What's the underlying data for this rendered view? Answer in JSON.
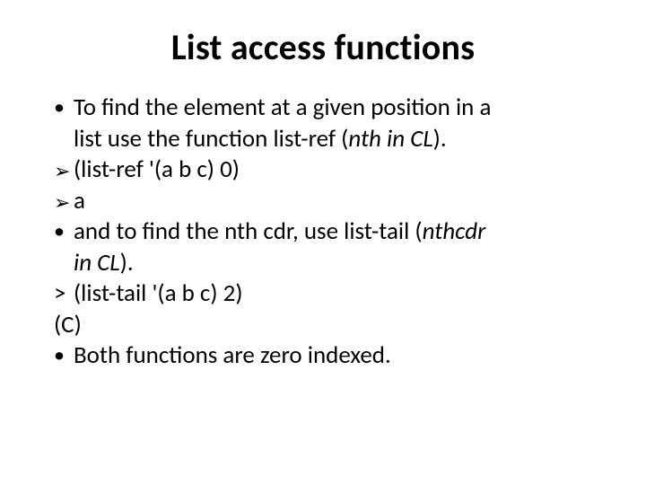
{
  "title": "List access functions",
  "lines": {
    "l1a": "To find the element at a given position in a",
    "l1b_plain": "list use the function list-ref (",
    "l1b_ital": "nth in CL",
    "l1b_tail": ").",
    "l2": "(list-ref  '(a  b  c) 0)",
    "l3": "a",
    "l4a_plain": "and to find the nth cdr,  use list-tail (",
    "l4a_ital": "nthcdr",
    "l4b_ital": "in CL",
    "l4b_tail": ").",
    "l5": "(list-tail  '(a  b  c) 2)",
    "l6": "(C)",
    "l7": "Both functions are zero indexed."
  },
  "bullets": {
    "dot": "•",
    "tri": "➢",
    "gt": ">"
  }
}
